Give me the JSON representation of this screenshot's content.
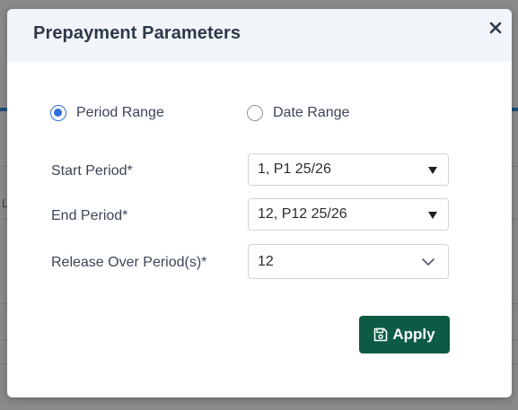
{
  "background": {
    "edge_letter": "L"
  },
  "modal": {
    "title": "Prepayment Parameters",
    "close_icon": "close-icon"
  },
  "range_type": {
    "options": [
      {
        "label": "Period Range",
        "selected": true
      },
      {
        "label": "Date Range",
        "selected": false
      }
    ]
  },
  "form": {
    "start_period": {
      "label": "Start Period*",
      "value": "1, P1 25/26"
    },
    "end_period": {
      "label": "End Period*",
      "value": "12, P12 25/26"
    },
    "release_over": {
      "label": "Release Over Period(s)*",
      "value": "12"
    }
  },
  "actions": {
    "apply_label": "Apply",
    "apply_icon": "save-icon"
  },
  "colors": {
    "header_bg": "#f1f4f8",
    "radio_accent": "#2f6fde",
    "apply_bg": "#0d5b45",
    "backdrop": "#8a8a8a"
  }
}
